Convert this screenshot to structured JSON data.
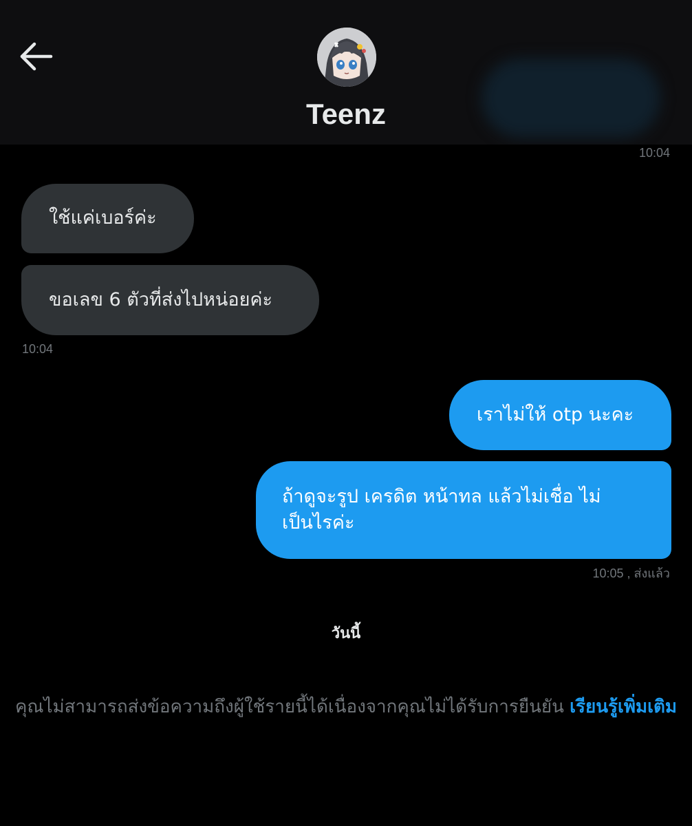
{
  "header": {
    "back_icon": "arrow-left-icon",
    "avatar_icon": "profile-avatar",
    "contact_name": "Teenz"
  },
  "messages": {
    "top_timestamp": "10:04",
    "incoming": [
      {
        "text": "ใช้แค่เบอร์ค่ะ"
      },
      {
        "text": "ขอเลข 6 ตัวที่ส่งไปหน่อยค่ะ"
      }
    ],
    "incoming_timestamp": "10:04",
    "outgoing": [
      {
        "text": "เราไม่ให้ otp นะคะ"
      },
      {
        "text": "ถ้าดูจะรูป  เครดิต  หน้าทล แล้วไม่เชื่อ  ไม่เป็นไรค่ะ"
      }
    ],
    "outgoing_timestamp": "10:05 , ส่งแล้ว"
  },
  "day_divider": "วันนี้",
  "notice": {
    "text": "คุณไม่สามารถส่งข้อความถึงผู้ใช้รายนี้ได้เนื่องจากคุณไม่ได้รับการยืนยัน ",
    "link": "เรียนรู้เพิ่มเติม"
  },
  "colors": {
    "background": "#000000",
    "header_background": "#0e0e10",
    "incoming_bubble": "#2f3336",
    "outgoing_bubble": "#1d9bf0",
    "muted_text": "#71767b",
    "accent": "#1d9bf0"
  }
}
